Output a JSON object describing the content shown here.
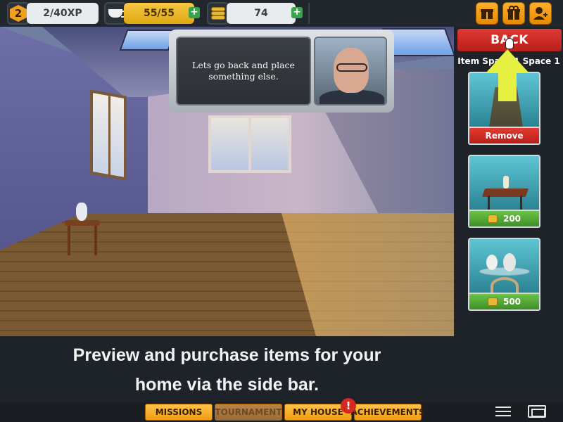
{
  "topbar": {
    "level": "2",
    "xp": "2/40XP",
    "energy": "55/55",
    "coins": "74",
    "plus": "+"
  },
  "dialog": {
    "text": "Lets go back and place something else."
  },
  "side_panel": {
    "back_label": "BACK",
    "item_space_label": "Item Space 1 Space 1",
    "remove_label": "Remove",
    "items": [
      {
        "price": "200"
      },
      {
        "price": "500"
      }
    ]
  },
  "caption": {
    "line1": "Preview and purchase items for your",
    "line2": "home via the side bar."
  },
  "bottom_nav": {
    "missions": "MISSIONS",
    "tournament": "TOURNAMENT",
    "my_house": "MY HOUSE",
    "achievements": "ACHIEVEMENTS",
    "alert": "!"
  },
  "colors": {
    "accent_orange": "#f29b13",
    "back_red": "#d42a22",
    "price_green": "#3d8f24",
    "arrow_yellow": "#e5f040"
  }
}
